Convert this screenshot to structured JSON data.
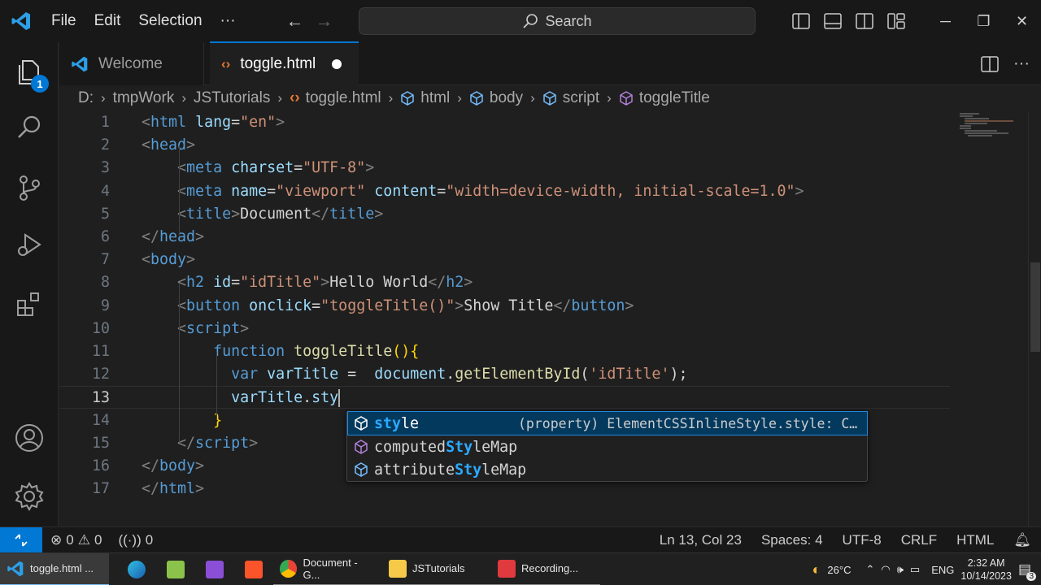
{
  "menu": [
    "File",
    "Edit",
    "Selection",
    "···"
  ],
  "search": {
    "label": "Search"
  },
  "window_controls": {
    "minimize": "─",
    "restore": "❐",
    "close": "✕"
  },
  "activity": {
    "explorer_badge": "1"
  },
  "tabs": [
    {
      "label": "Welcome"
    },
    {
      "label": "toggle.html"
    }
  ],
  "breadcrumb": [
    "D:",
    "tmpWork",
    "JSTutorials",
    "toggle.html",
    "html",
    "body",
    "script",
    "toggleTitle"
  ],
  "code": [
    {
      "n": "1",
      "tokens": [
        [
          "t-br",
          "<"
        ],
        [
          "t-tag",
          "html"
        ],
        [
          "t-txt",
          " "
        ],
        [
          "t-attr",
          "lang"
        ],
        [
          "t-txt",
          "="
        ],
        [
          "t-str",
          "\"en\""
        ],
        [
          "t-br",
          ">"
        ]
      ]
    },
    {
      "n": "2",
      "tokens": [
        [
          "t-br",
          "<"
        ],
        [
          "t-tag",
          "head"
        ],
        [
          "t-br",
          ">"
        ]
      ]
    },
    {
      "n": "3",
      "tokens": [
        [
          "t-txt",
          "    "
        ],
        [
          "t-br",
          "<"
        ],
        [
          "t-tag",
          "meta"
        ],
        [
          "t-txt",
          " "
        ],
        [
          "t-attr",
          "charset"
        ],
        [
          "t-txt",
          "="
        ],
        [
          "t-str",
          "\"UTF-8\""
        ],
        [
          "t-br",
          ">"
        ]
      ]
    },
    {
      "n": "4",
      "tokens": [
        [
          "t-txt",
          "    "
        ],
        [
          "t-br",
          "<"
        ],
        [
          "t-tag",
          "meta"
        ],
        [
          "t-txt",
          " "
        ],
        [
          "t-attr",
          "name"
        ],
        [
          "t-txt",
          "="
        ],
        [
          "t-str",
          "\"viewport\""
        ],
        [
          "t-txt",
          " "
        ],
        [
          "t-attr",
          "content"
        ],
        [
          "t-txt",
          "="
        ],
        [
          "t-str",
          "\"width=device-width, initial-scale=1.0\""
        ],
        [
          "t-br",
          ">"
        ]
      ]
    },
    {
      "n": "5",
      "tokens": [
        [
          "t-txt",
          "    "
        ],
        [
          "t-br",
          "<"
        ],
        [
          "t-tag",
          "title"
        ],
        [
          "t-br",
          ">"
        ],
        [
          "t-txt",
          "Document"
        ],
        [
          "t-br",
          "</"
        ],
        [
          "t-tag",
          "title"
        ],
        [
          "t-br",
          ">"
        ]
      ]
    },
    {
      "n": "6",
      "tokens": [
        [
          "t-br",
          "</"
        ],
        [
          "t-tag",
          "head"
        ],
        [
          "t-br",
          ">"
        ]
      ]
    },
    {
      "n": "7",
      "tokens": [
        [
          "t-br",
          "<"
        ],
        [
          "t-tag",
          "body"
        ],
        [
          "t-br",
          ">"
        ]
      ]
    },
    {
      "n": "8",
      "tokens": [
        [
          "t-txt",
          "    "
        ],
        [
          "t-br",
          "<"
        ],
        [
          "t-tag",
          "h2"
        ],
        [
          "t-txt",
          " "
        ],
        [
          "t-attr",
          "id"
        ],
        [
          "t-txt",
          "="
        ],
        [
          "t-str",
          "\"idTitle\""
        ],
        [
          "t-br",
          ">"
        ],
        [
          "t-txt",
          "Hello World"
        ],
        [
          "t-br",
          "</"
        ],
        [
          "t-tag",
          "h2"
        ],
        [
          "t-br",
          ">"
        ]
      ]
    },
    {
      "n": "9",
      "tokens": [
        [
          "t-txt",
          "    "
        ],
        [
          "t-br",
          "<"
        ],
        [
          "t-tag",
          "button"
        ],
        [
          "t-txt",
          " "
        ],
        [
          "t-attr",
          "onclick"
        ],
        [
          "t-txt",
          "="
        ],
        [
          "t-str",
          "\"toggleTitle()\""
        ],
        [
          "t-br",
          ">"
        ],
        [
          "t-txt",
          "Show Title"
        ],
        [
          "t-br",
          "</"
        ],
        [
          "t-tag",
          "button"
        ],
        [
          "t-br",
          ">"
        ]
      ]
    },
    {
      "n": "10",
      "tokens": [
        [
          "t-txt",
          "    "
        ],
        [
          "t-br",
          "<"
        ],
        [
          "t-tag",
          "script"
        ],
        [
          "t-br",
          ">"
        ]
      ]
    },
    {
      "n": "11",
      "tokens": [
        [
          "t-txt",
          "        "
        ],
        [
          "t-kw",
          "function"
        ],
        [
          "t-txt",
          " "
        ],
        [
          "t-fn",
          "toggleTitle"
        ],
        [
          "t-brk",
          "(){"
        ]
      ]
    },
    {
      "n": "12",
      "tokens": [
        [
          "t-txt",
          "          "
        ],
        [
          "t-kw",
          "var"
        ],
        [
          "t-txt",
          " "
        ],
        [
          "t-var",
          "varTitle"
        ],
        [
          "t-txt",
          " =  "
        ],
        [
          "t-var",
          "document"
        ],
        [
          "t-txt",
          "."
        ],
        [
          "t-fn",
          "getElementById"
        ],
        [
          "t-txt",
          "("
        ],
        [
          "t-str",
          "'idTitle'"
        ],
        [
          "t-txt",
          ");"
        ]
      ]
    },
    {
      "n": "13",
      "tokens": [
        [
          "t-txt",
          "          "
        ],
        [
          "t-var",
          "varTitle"
        ],
        [
          "t-txt",
          "."
        ],
        [
          "t-var",
          "sty"
        ]
      ]
    },
    {
      "n": "14",
      "tokens": [
        [
          "t-txt",
          "        "
        ],
        [
          "t-brk",
          "}"
        ]
      ]
    },
    {
      "n": "15",
      "tokens": [
        [
          "t-txt",
          "    "
        ],
        [
          "t-br",
          "</"
        ],
        [
          "t-tag",
          "script"
        ],
        [
          "t-br",
          ">"
        ]
      ]
    },
    {
      "n": "16",
      "tokens": [
        [
          "t-br",
          "</"
        ],
        [
          "t-tag",
          "body"
        ],
        [
          "t-br",
          ">"
        ]
      ]
    },
    {
      "n": "17",
      "tokens": [
        [
          "t-br",
          "</"
        ],
        [
          "t-tag",
          "html"
        ],
        [
          "t-br",
          ">"
        ]
      ]
    }
  ],
  "suggest": [
    {
      "pre": "",
      "match": "sty",
      "post": "le",
      "detail": "(property) ElementCSSInlineStyle.style: C…"
    },
    {
      "pre": "computed",
      "match": "Sty",
      "post": "leMap",
      "detail": ""
    },
    {
      "pre": "attribute",
      "match": "Sty",
      "post": "leMap",
      "detail": ""
    }
  ],
  "status": {
    "errors": "0",
    "warnings": "0",
    "ports": "0",
    "position": "Ln 13, Col 23",
    "spaces": "Spaces: 4",
    "encoding": "UTF-8",
    "eol": "CRLF",
    "language": "HTML"
  },
  "taskbar": {
    "apps": [
      "Document - G...",
      "JSTutorials",
      "Recording...",
      "toggle.html ..."
    ],
    "weather": "26°C",
    "lang": "ENG",
    "time": "2:32 AM",
    "date": "10/14/2023",
    "notif_count": "3"
  },
  "colors": {
    "accent": "#0078d4",
    "tag": "#569cd6",
    "string": "#ce9178",
    "attribute": "#9cdcfe",
    "function": "#dcdcaa"
  }
}
